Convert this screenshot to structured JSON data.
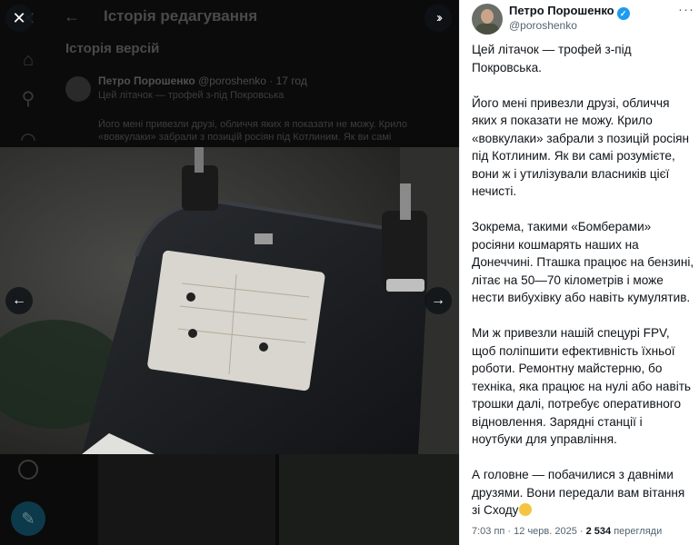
{
  "background": {
    "header_title": "Історія редагування",
    "section_title": "Історія версій",
    "author_name": "Петро Порошенко",
    "author_meta": "@poroshenko · 17 год",
    "lines": [
      "Цей літачок — трофей з-під Покровська",
      "Його мені привезли друзі, обличчя яких я показати не можу. Крило",
      "«вовкулаки» забрали з позицій росіян під Котлиним. Як ви самі"
    ]
  },
  "viewer": {
    "close_icon": "close-icon",
    "expand_icon": "double-chevron-right-icon",
    "prev_icon": "arrow-left-icon",
    "next_icon": "arrow-right-icon"
  },
  "tweet": {
    "author_name": "Петро Порошенко",
    "handle": "@poroshenko",
    "more_label": "···",
    "paragraphs": [
      "Цей літачок — трофей з-під Покровська.",
      "Його мені привезли друзі, обличчя яких я показати не можу. Крило «вовкулаки» забрали з позицій росіян під Котлиним. Як ви самі розумієте, вони ж і утилізували власників цієї нечисті.",
      "Зокрема, такими «Бомберами» росіяни кошмарять наших на Донеччині. Пташка працює на бензині, літає на 50—70 кілометрів і може нести вибухівку або навіть кумулятив.",
      "Ми ж привезли нашій спецурі FPV, щоб поліпшити ефективність їхньої роботи. Ремонтну майстерню, бо техніка, яка працює на нулі або навіть трошки далі, потребує оперативного відновлення. Зарядні станції і ноутбуки для управління.",
      "А головне — побачилися з давніми друзями. Вони передали вам вітання зі Сходу"
    ],
    "time": "7:03 пп · 12 черв. 2025 · ",
    "views_count": "2 534",
    "views_label": " перегляди"
  }
}
